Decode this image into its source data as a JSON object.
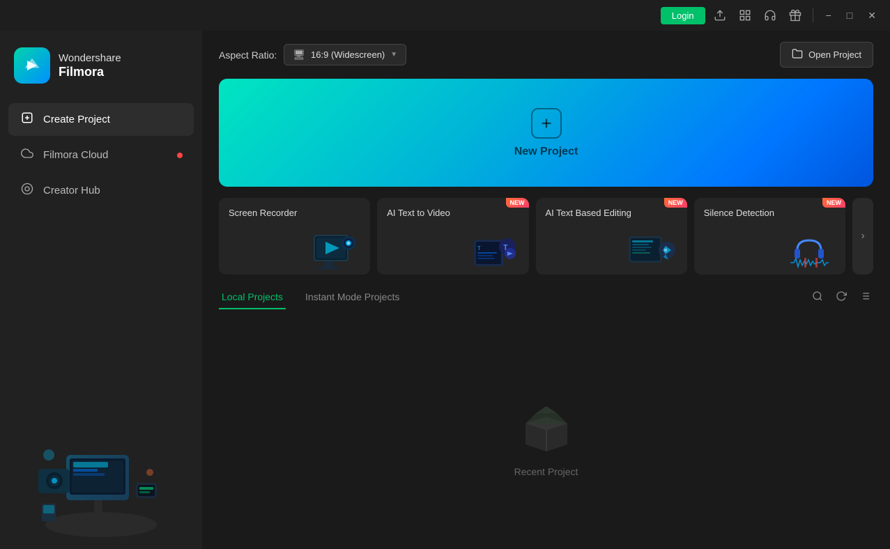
{
  "titlebar": {
    "login_label": "Login",
    "minimize_label": "−",
    "maximize_label": "□",
    "close_label": "✕"
  },
  "sidebar": {
    "brand": "Wondershare",
    "product": "Filmora",
    "nav_items": [
      {
        "id": "create-project",
        "label": "Create Project",
        "icon": "➕",
        "active": true
      },
      {
        "id": "filmora-cloud",
        "label": "Filmora Cloud",
        "icon": "☁",
        "dot": true
      },
      {
        "id": "creator-hub",
        "label": "Creator Hub",
        "icon": "◎",
        "dot": false
      }
    ]
  },
  "content": {
    "aspect_ratio": {
      "label": "Aspect Ratio:",
      "selected": "16:9 (Widescreen)"
    },
    "open_project_label": "Open Project",
    "new_project": {
      "label": "New Project"
    },
    "feature_cards": [
      {
        "id": "screen-recorder",
        "label": "Screen Recorder",
        "new": false
      },
      {
        "id": "ai-text-to-video",
        "label": "AI Text to Video",
        "new": true
      },
      {
        "id": "ai-text-editing",
        "label": "AI Text Based Editing",
        "new": true
      },
      {
        "id": "silence-detection",
        "label": "Silence Detection",
        "new": true
      }
    ],
    "tabs": [
      {
        "id": "local-projects",
        "label": "Local Projects",
        "active": true
      },
      {
        "id": "instant-mode",
        "label": "Instant Mode Projects",
        "active": false
      }
    ],
    "empty_state_label": "Recent Project"
  }
}
